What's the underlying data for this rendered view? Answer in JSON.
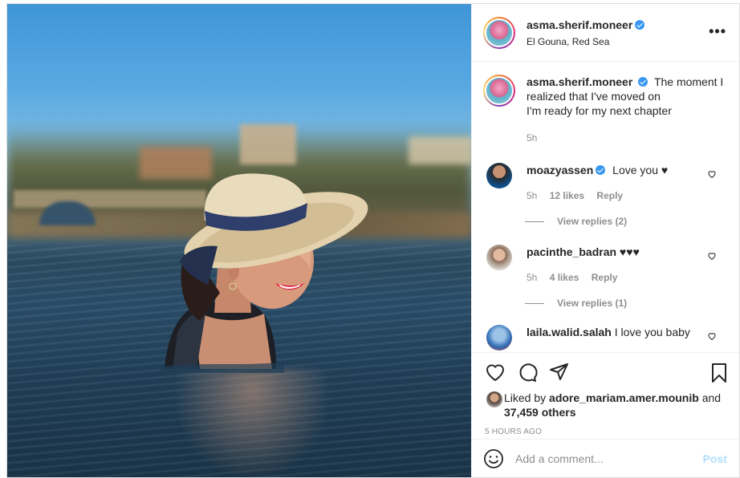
{
  "post": {
    "author": "asma.sherif.moneer",
    "location": "El Gouna, Red Sea",
    "more_icon": "more-horizontal-icon",
    "caption": {
      "line1": "The moment I realized that I've moved on ",
      "line2": "I'm ready for my next chapter ",
      "time": "5h"
    },
    "comments": [
      {
        "user": "moazyassen",
        "verified": true,
        "text": "Love you ",
        "time": "5h",
        "likes": "12 likes",
        "reply": "Reply",
        "view_replies": "View replies (2)"
      },
      {
        "user": "pacinthe_badran",
        "verified": false,
        "text": "",
        "time": "5h",
        "likes": "4 likes",
        "reply": "Reply",
        "view_replies": "View replies (1)"
      },
      {
        "user": "laila.walid.salah",
        "verified": false,
        "text": "I love you baby"
      }
    ],
    "liked_by_prefix": "Liked by",
    "liked_by_user": "adore_mariam.amer.mounib",
    "liked_by_and": "and",
    "liked_by_others": "37,459 others",
    "timestamp": "5 HOURS AGO",
    "comment_placeholder": "Add a comment...",
    "post_button": "Post"
  },
  "colors": {
    "verified": "#3897f0",
    "post_button_disabled": "#b2dffc",
    "secondary_text": "#8e8e8e"
  }
}
